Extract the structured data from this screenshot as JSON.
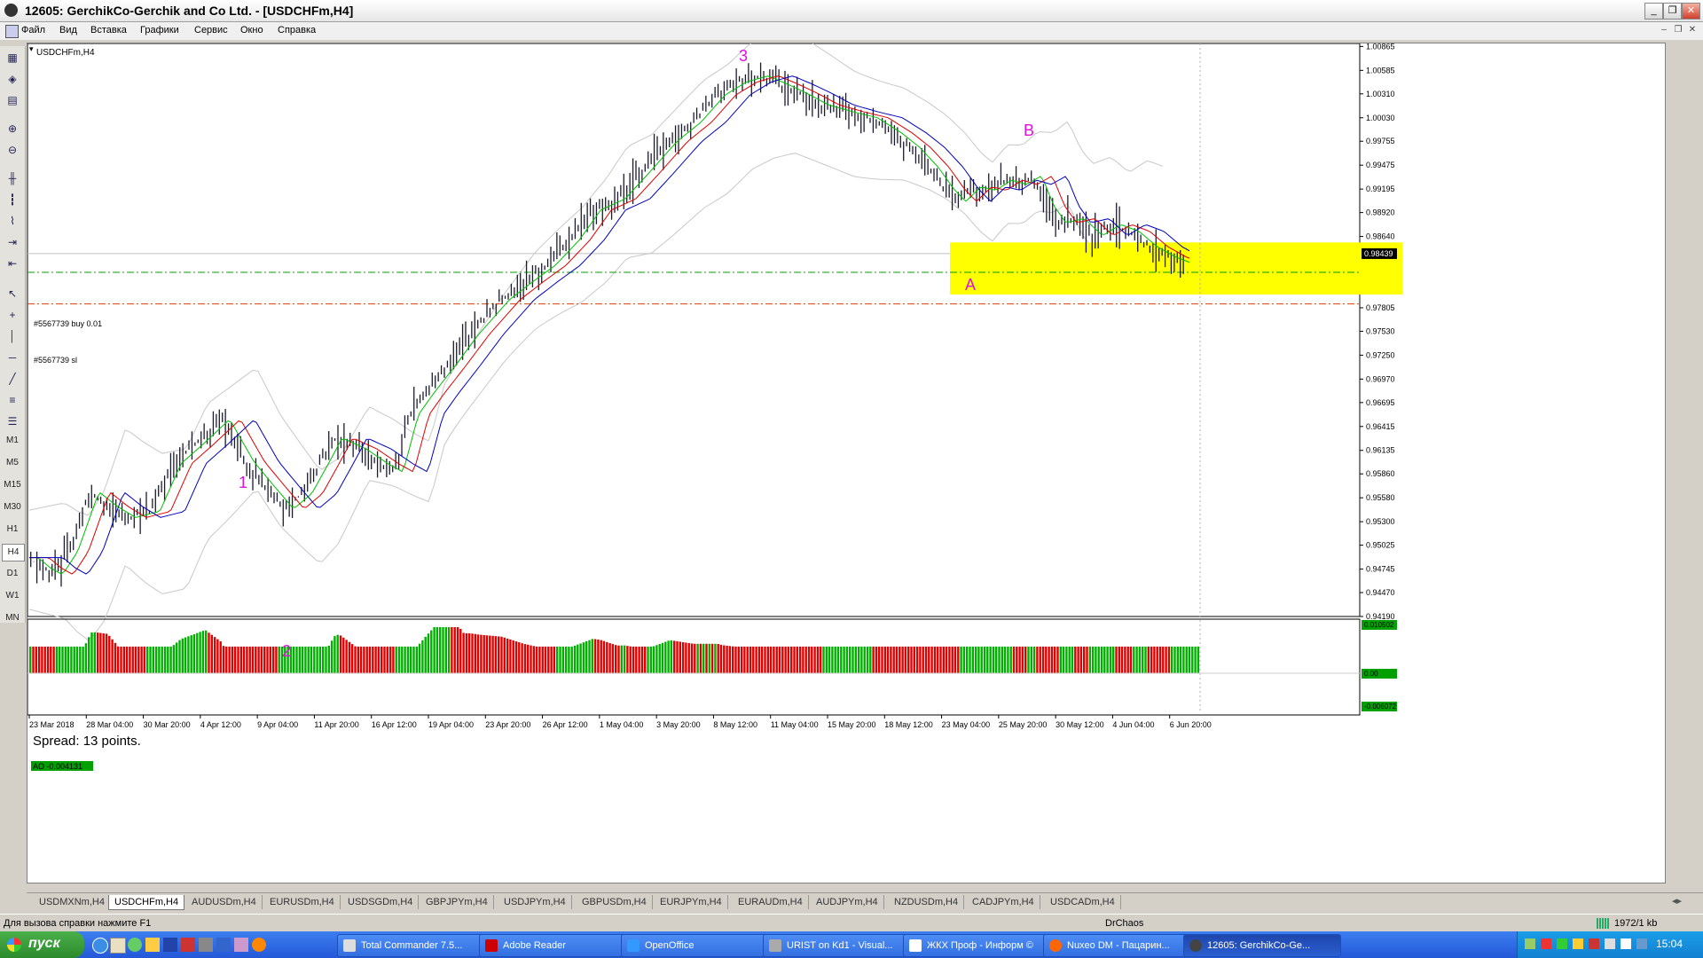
{
  "window": {
    "title": "12605: GerchikCo-Gerchik and Co Ltd. - [USDCHFm,H4]",
    "min_label": "_",
    "max_label": "❐",
    "close_label": "✕"
  },
  "menu": [
    "Файл",
    "Вид",
    "Вставка",
    "Графики",
    "Сервис",
    "Окно",
    "Справка"
  ],
  "timeframes": [
    "M1",
    "M5",
    "M15",
    "M30",
    "H1",
    "H4",
    "D1",
    "W1",
    "MN"
  ],
  "active_timeframe": "H4",
  "chart": {
    "symbol_label": "USDCHFm,H4",
    "spread_text": "Spread: 13 points.",
    "order_buy_label": "#5567739 buy 0.01",
    "order_sl_label": "#5567739 sl",
    "current_price": "0.98439",
    "wave_labels": [
      "1",
      "2",
      "3",
      "A",
      "B"
    ],
    "price_scale": [
      "1.00865",
      "1.00585",
      "1.00310",
      "1.00030",
      "0.99755",
      "0.99475",
      "0.99195",
      "0.98920",
      "0.98640",
      "0.98360",
      "0.98085",
      "0.97805",
      "0.97530",
      "0.97250",
      "0.96970",
      "0.96695",
      "0.96415",
      "0.96135",
      "0.95860",
      "0.95580",
      "0.95300",
      "0.95025",
      "0.94745",
      "0.94470",
      "0.94190"
    ],
    "time_scale": [
      "23 Mar 2018",
      "28 Mar 04:00",
      "30 Mar 20:00",
      "4 Apr 12:00",
      "9 Apr 04:00",
      "11 Apr 20:00",
      "16 Apr 12:00",
      "19 Apr 04:00",
      "23 Apr 20:00",
      "26 Apr 12:00",
      "1 May 04:00",
      "3 May 20:00",
      "8 May 12:00",
      "11 May 04:00",
      "15 May 20:00",
      "18 May 12:00",
      "23 May 04:00",
      "25 May 20:00",
      "30 May 12:00",
      "4 Jun 04:00",
      "6 Jun 20:00"
    ],
    "ao_label": "AO -0.004131",
    "ao_scale": [
      "0.010502",
      "0.00",
      "-0.006072"
    ],
    "colors": {
      "bull": "#00b000",
      "bear": "#e00000",
      "zone": "#ffff00",
      "label": "#e010e0",
      "ma_fast": "#00c000",
      "ma_mid": "#e00000",
      "ma_slow": "#0000c0",
      "order": "#00a000",
      "sl": "#e04000"
    }
  },
  "chart_data": {
    "type": "candlestick",
    "title": "USDCHFm,H4",
    "ylim": [
      0.9419,
      1.009
    ],
    "x_range": [
      "23 Mar 2018",
      "6 Jun 20:00"
    ],
    "overlays": [
      "Moving averages (green, red, blue)",
      "Envelope bands (gray)",
      "Fractals"
    ],
    "levels": [
      {
        "name": "#5567739 buy 0.01",
        "value": 0.9822
      },
      {
        "name": "#5567739 sl",
        "value": 0.9785
      }
    ],
    "zone": {
      "from": 0.9796,
      "to": 0.9857,
      "x_from": "23 May 04:00",
      "x_to": "after 6 Jun 20:00"
    },
    "subchart": {
      "name": "AO",
      "value": -0.004131,
      "ylim": [
        -0.006072,
        0.010502
      ]
    }
  },
  "tabs": [
    "USDMXNm,H4",
    "USDCHFm,H4",
    "AUDUSDm,H4",
    "EURUSDm,H4",
    "USDSGDm,H4",
    "GBPJPYm,H4",
    "USDJPYm,H4",
    "GBPUSDm,H4",
    "EURJPYm,H4",
    "EURAUDm,H4",
    "AUDJPYm,H4",
    "NZDUSDm,H4",
    "CADJPYm,H4",
    "USDCADm,H4"
  ],
  "active_tab": 1,
  "status": {
    "help": "Для вызова справки нажмите F1",
    "profile": "DrChaos",
    "traffic": "1972/1 kb"
  },
  "taskbar": {
    "start_label": "пуск",
    "tasks": [
      "Total Commander 7.5...",
      "Adobe Reader",
      "OpenOffice",
      "URIST on Kd1 - Visual...",
      "ЖКХ Проф - Информ ©",
      "Nuxeo DM - Пацарин...",
      "12605: GerchikCo-Ge..."
    ],
    "clock": "15:04"
  }
}
